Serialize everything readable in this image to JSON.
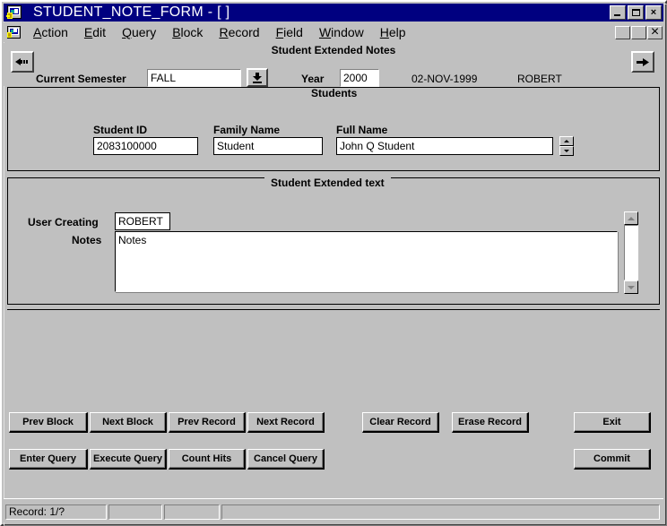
{
  "window": {
    "title": "STUDENT_NOTE_FORM - [ ]",
    "app_icon": "form-app-icon",
    "buttons": {
      "minimize": "_",
      "maximize": "□",
      "close": "×",
      "mdi_minimize": "_",
      "mdi_restore": "❐",
      "mdi_close": "×"
    }
  },
  "menubar": {
    "icon": "form-doc-icon",
    "items": [
      {
        "label": "Action",
        "accel": "A"
      },
      {
        "label": "Edit",
        "accel": "E"
      },
      {
        "label": "Query",
        "accel": "Q"
      },
      {
        "label": "Block",
        "accel": "B"
      },
      {
        "label": "Record",
        "accel": "R"
      },
      {
        "label": "Field",
        "accel": "F"
      },
      {
        "label": "Window",
        "accel": "W"
      },
      {
        "label": "Help",
        "accel": "H"
      }
    ]
  },
  "header": {
    "title": "Student Extended Notes",
    "back_button_icon": "left-arrow-icon",
    "forward_button_icon": "right-arrow-icon",
    "semester_label": "Current Semester",
    "semester_value": "FALL",
    "semester_lov_icon": "down-arrow-lov-icon",
    "year_label": "Year",
    "year_value": "2000",
    "date": "02-NOV-1999",
    "user": "ROBERT"
  },
  "students_block": {
    "frame_title": "Students",
    "student_id_label": "Student ID",
    "student_id_value": "2083100000",
    "family_name_label": "Family Name",
    "family_name_value": "Student",
    "full_name_label": "Full Name",
    "full_name_value": "John Q Student",
    "spinner_up_icon": "spin-up-icon",
    "spinner_down_icon": "spin-down-icon"
  },
  "extended_text_block": {
    "frame_title": "Student Extended text",
    "user_creating_label": "User Creating",
    "user_creating_value": "ROBERT",
    "notes_label": "Notes",
    "notes_value": "Notes",
    "scroll_up_icon": "scroll-up-icon",
    "scroll_down_icon": "scroll-down-icon"
  },
  "actions": {
    "row1": [
      {
        "label": "Prev Block",
        "name": "prev-block-button"
      },
      {
        "label": "Next Block",
        "name": "next-block-button"
      },
      {
        "label": "Prev Record",
        "name": "prev-record-button"
      },
      {
        "label": "Next Record",
        "name": "next-record-button"
      },
      {
        "label": "Clear Record",
        "name": "clear-record-button"
      },
      {
        "label": "Erase Record",
        "name": "erase-record-button"
      },
      {
        "label": "Exit",
        "name": "exit-button"
      }
    ],
    "row2": [
      {
        "label": "Enter Query",
        "name": "enter-query-button"
      },
      {
        "label": "Execute Query",
        "name": "execute-query-button"
      },
      {
        "label": "Count Hits",
        "name": "count-hits-button"
      },
      {
        "label": "Cancel Query",
        "name": "cancel-query-button"
      },
      {
        "label": "Commit",
        "name": "commit-button"
      }
    ]
  },
  "statusbar": {
    "record": "Record: 1/?",
    "cell2": "",
    "cell3": "",
    "cell4": ""
  },
  "colors": {
    "titlebar": "#000080",
    "face": "#c0c0c0",
    "field_bg": "#ffffff",
    "text": "#000000"
  }
}
